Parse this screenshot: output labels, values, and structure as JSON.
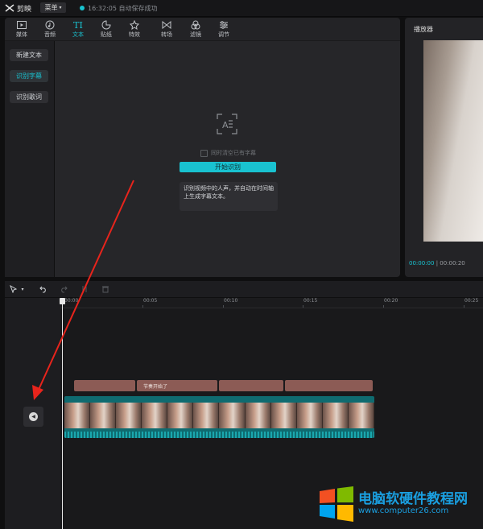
{
  "titlebar": {
    "app_name": "剪映",
    "menu_label": "菜单",
    "autosave_status": "16:32:05 自动保存成功"
  },
  "toolbar": {
    "tools": [
      {
        "label": "媒体",
        "icon": "media-icon"
      },
      {
        "label": "音频",
        "icon": "audio-icon"
      },
      {
        "label": "文本",
        "icon": "text-icon",
        "active": true
      },
      {
        "label": "贴纸",
        "icon": "sticker-icon"
      },
      {
        "label": "特效",
        "icon": "effects-icon"
      },
      {
        "label": "转场",
        "icon": "transition-icon"
      },
      {
        "label": "滤镜",
        "icon": "filter-icon"
      },
      {
        "label": "调节",
        "icon": "adjust-icon"
      }
    ]
  },
  "sidebar": {
    "items": [
      "新建文本",
      "识别字幕",
      "识别歌词"
    ],
    "active_index": 1
  },
  "recognition": {
    "clear_existing_label": "同时清空已有字幕",
    "start_button": "开始识别",
    "tip_text": "识别视频中的人声，并自动在时间轴上生成字幕文本。"
  },
  "player": {
    "title": "播放器",
    "current_time": "00:00:00",
    "total_time": "00:00:20"
  },
  "timeline": {
    "ruler_labels": [
      "00:00",
      "00:05",
      "00:10",
      "00:15",
      "00:20",
      "00:25"
    ],
    "subtitle_clip_text": "节奏开始了"
  },
  "watermark": {
    "title": "电脑软硬件教程网",
    "url": "www.computer26.com"
  },
  "colors": {
    "accent": "#19c2d0",
    "arrow": "#e8241c"
  }
}
